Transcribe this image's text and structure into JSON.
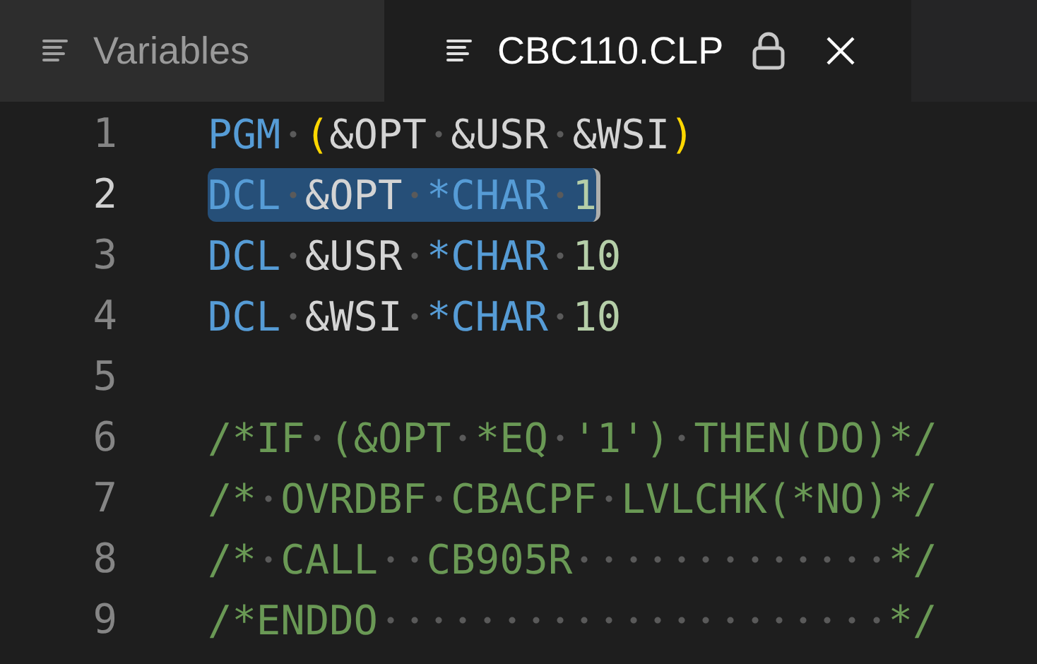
{
  "tabs": [
    {
      "label": "Variables",
      "selected": false,
      "locked": false,
      "closable": false
    },
    {
      "label": "CBC110.CLP",
      "selected": true,
      "locked": true,
      "closable": true
    }
  ],
  "lines": [
    {
      "number": "1",
      "selected": false,
      "tokens": [
        {
          "kind": "keyword",
          "text": "PGM "
        },
        {
          "kind": "paren",
          "text": "("
        },
        {
          "kind": "plain",
          "text": "&OPT &USR &WSI"
        },
        {
          "kind": "paren",
          "text": ")"
        }
      ]
    },
    {
      "number": "2",
      "selected": true,
      "tokens": [
        {
          "kind": "keyword",
          "text": "DCL"
        },
        {
          "kind": "plain",
          "text": " &OPT "
        },
        {
          "kind": "type",
          "text": "*CHAR "
        },
        {
          "kind": "number",
          "text": "1"
        }
      ]
    },
    {
      "number": "3",
      "selected": false,
      "tokens": [
        {
          "kind": "keyword",
          "text": "DCL"
        },
        {
          "kind": "plain",
          "text": " &USR "
        },
        {
          "kind": "type",
          "text": "*CHAR "
        },
        {
          "kind": "number",
          "text": "10"
        }
      ]
    },
    {
      "number": "4",
      "selected": false,
      "tokens": [
        {
          "kind": "keyword",
          "text": "DCL"
        },
        {
          "kind": "plain",
          "text": " &WSI "
        },
        {
          "kind": "type",
          "text": "*CHAR "
        },
        {
          "kind": "number",
          "text": "10"
        }
      ]
    },
    {
      "number": "5",
      "selected": false
    },
    {
      "number": "6",
      "selected": false,
      "tokens": [
        {
          "kind": "comment",
          "text": "/*IF (&OPT *EQ '1') THEN(DO)*/"
        }
      ]
    },
    {
      "number": "7",
      "selected": false,
      "tokens": [
        {
          "kind": "comment",
          "text": "/* OVRDBF CBACPF LVLCHK(*NO)*/"
        }
      ]
    },
    {
      "number": "8",
      "selected": false,
      "tokens": [
        {
          "kind": "comment",
          "text": "/* CALL  CB905R             */"
        }
      ]
    },
    {
      "number": "9",
      "selected": false,
      "tokens": [
        {
          "kind": "comment",
          "text": "/*ENDDO                     */"
        }
      ]
    }
  ]
}
